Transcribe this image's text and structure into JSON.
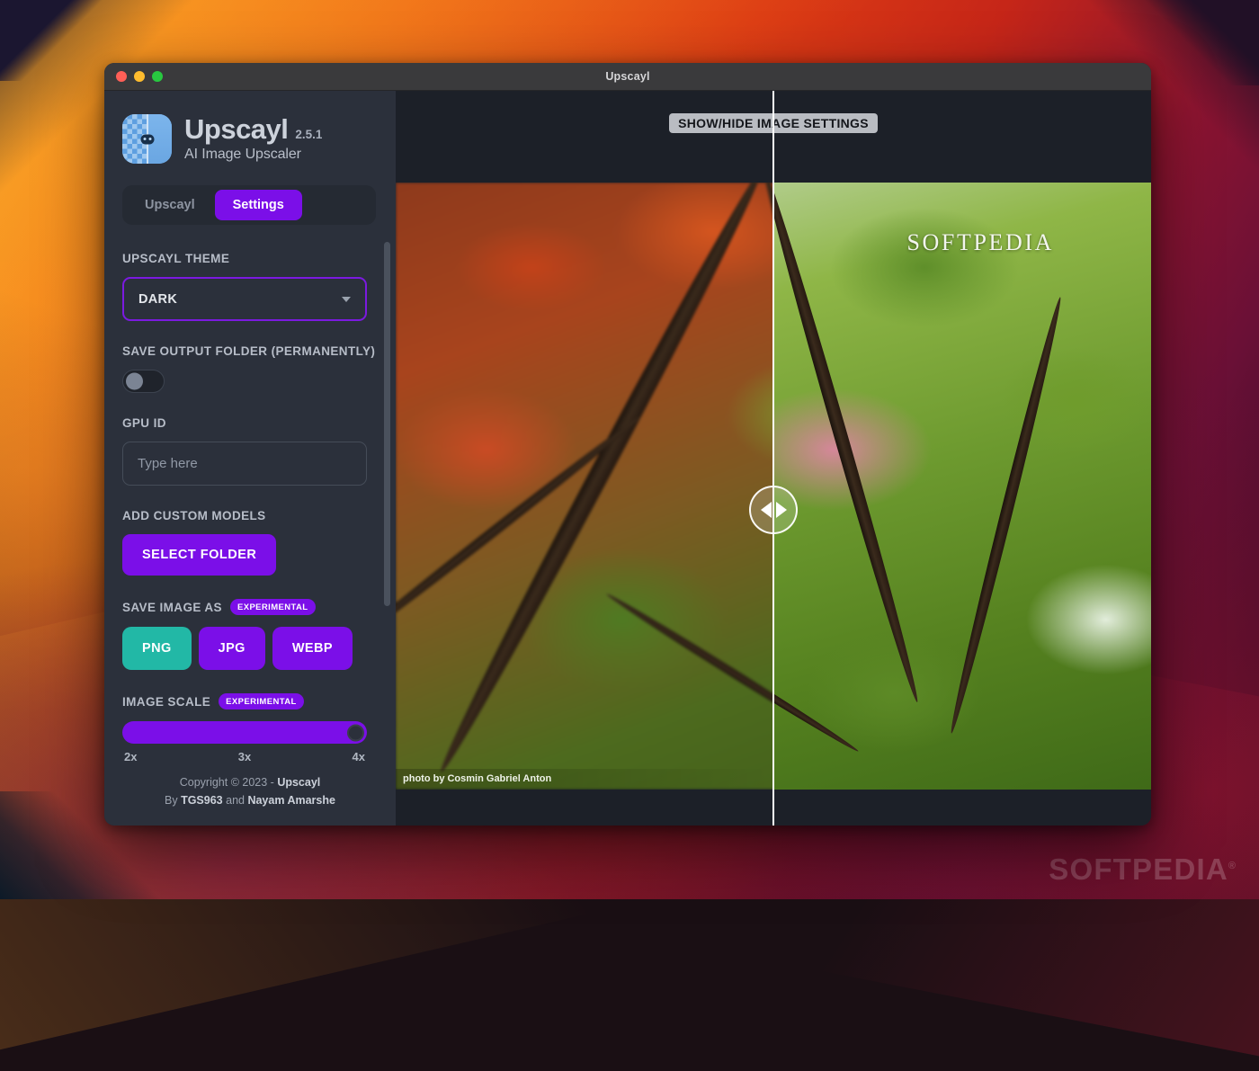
{
  "desktop": {
    "watermark": "SOFTPEDIA",
    "watermark_reg": "®"
  },
  "window": {
    "title": "Upscayl",
    "traffic_lights": [
      "close-button",
      "minimize-button",
      "maximize-button"
    ]
  },
  "sidebar": {
    "brand": {
      "name": "Upscayl",
      "version": "2.5.1",
      "tagline": "AI Image Upscaler",
      "logo_icon": "upscayl-logo-icon"
    },
    "tabs": [
      {
        "label": "Upscayl",
        "active": false
      },
      {
        "label": "Settings",
        "active": true
      }
    ],
    "settings": {
      "theme": {
        "label": "UPSCAYL THEME",
        "value": "DARK",
        "options": [
          "DARK"
        ],
        "caret_icon": "chevron-down-icon"
      },
      "save_output_folder": {
        "label": "SAVE OUTPUT FOLDER (PERMANENTLY)",
        "enabled": false
      },
      "gpu_id": {
        "label": "GPU ID",
        "value": "",
        "placeholder": "Type here"
      },
      "custom_models": {
        "label": "ADD CUSTOM MODELS",
        "button_label": "SELECT FOLDER"
      },
      "save_image_as": {
        "label": "SAVE IMAGE AS",
        "badge": "EXPERIMENTAL",
        "options": [
          "PNG",
          "JPG",
          "WEBP"
        ],
        "selected": "PNG"
      },
      "image_scale": {
        "label": "IMAGE SCALE",
        "badge": "EXPERIMENTAL",
        "ticks": [
          "2x",
          "3x",
          "4x"
        ],
        "value": "4x",
        "percent": 100
      }
    },
    "footer": {
      "line1_prefix": "Copyright © 2023 - ",
      "line1_bold": "Upscayl",
      "line2_prefix": "By ",
      "line2_bold1": "TGS963",
      "line2_middle": " and ",
      "line2_bold2": "Nayam Amarshe"
    }
  },
  "image_panel": {
    "show_hide_button": "SHOW/HIDE IMAGE SETTINGS",
    "watermark": "SOFTPEDIA",
    "photo_credit": "photo by Cosmin Gabriel Anton",
    "split_handle_icon": "left-right-arrows-icon",
    "split_position_percent": 50
  },
  "colors": {
    "accent_purple": "#7b0fe8",
    "selected_teal": "#22b8a6",
    "sidebar_bg": "#2b303b",
    "panel_bg": "#1c2028",
    "titlebar_bg": "#3a3a3c"
  }
}
